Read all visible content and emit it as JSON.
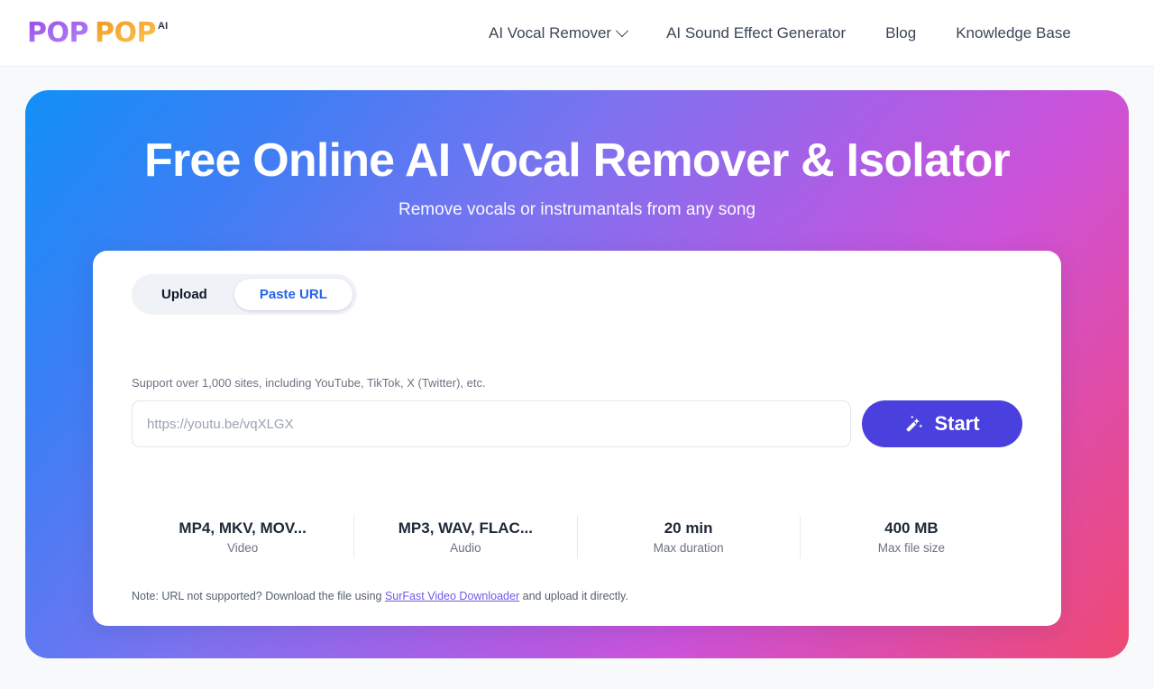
{
  "header": {
    "logo": {
      "word_one": "POP",
      "word_two": "POP",
      "suffix": "AI"
    },
    "nav": [
      {
        "label": "AI Vocal Remover",
        "has_dropdown": true
      },
      {
        "label": "AI Sound Effect Generator",
        "has_dropdown": false
      },
      {
        "label": "Blog",
        "has_dropdown": false
      },
      {
        "label": "Knowledge Base",
        "has_dropdown": false
      }
    ]
  },
  "hero": {
    "title": "Free Online AI Vocal Remover & Isolator",
    "subtitle": "Remove vocals or instrumantals from any song",
    "gradient": {
      "top_left": "#1290f7",
      "bottom_left": "#7b73f0",
      "top_right": "#cc52d9",
      "bottom_right": "#ef4a73"
    }
  },
  "panel": {
    "tabs": [
      {
        "label": "Upload",
        "active": false
      },
      {
        "label": "Paste URL",
        "active": true
      }
    ],
    "support_note": "Support over 1,000 sites, including YouTube, TikTok, X (Twitter), etc.",
    "url_input": {
      "value": "",
      "placeholder": "https://youtu.be/vqXLGX"
    },
    "start_button": {
      "label": "Start",
      "icon": "magic-wand-icon",
      "color": "#4a40dd"
    },
    "specs": [
      {
        "value": "MP4, MKV, MOV...",
        "label": "Video"
      },
      {
        "value": "MP3, WAV, FLAC...",
        "label": "Audio"
      },
      {
        "value": "20 min",
        "label": "Max duration"
      },
      {
        "value": "400 MB",
        "label": "Max file size"
      }
    ],
    "foot_note": {
      "prefix": "Note: URL not supported? Download the file using ",
      "link": "SurFast Video Downloader",
      "suffix": " and upload it directly.",
      "link_color": "#6c5ce7"
    }
  }
}
